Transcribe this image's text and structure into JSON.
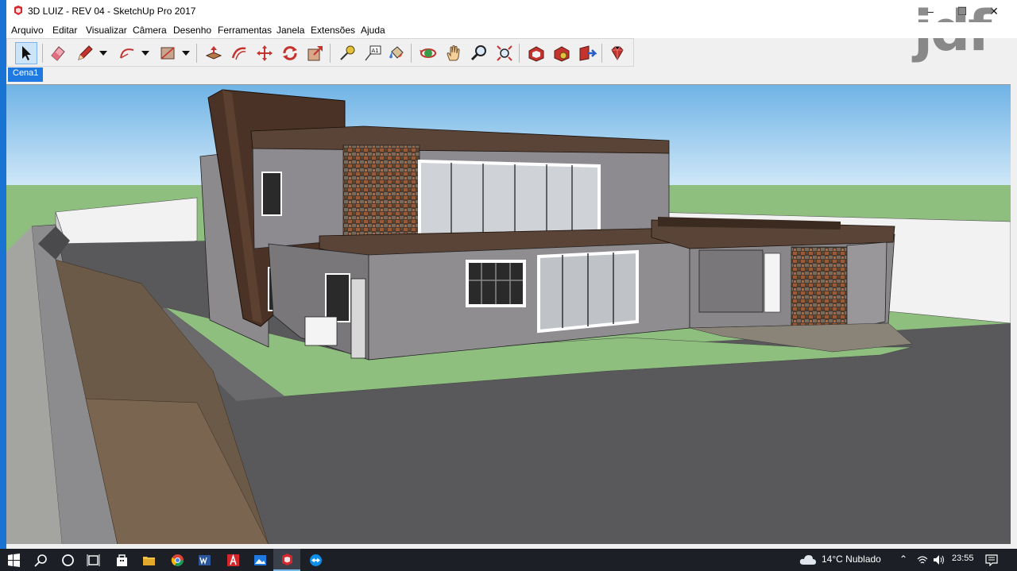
{
  "window": {
    "title": "3D LUIZ - REV 04 - SketchUp Pro 2017",
    "minimize_label": "–",
    "maximize_label": "☐",
    "close_label": "✕"
  },
  "watermark": "jdf",
  "menu": [
    "Arquivo",
    "Editar",
    "Visualizar",
    "Câmera",
    "Desenho",
    "Ferramentas",
    "Janela",
    "Extensões",
    "Ajuda"
  ],
  "toolbar": {
    "tools": [
      "select-tool",
      "eraser-tool",
      "line-tool",
      "arc-tool",
      "rectangle-tool",
      "push-pull-tool",
      "offset-tool",
      "move-tool",
      "rotate-tool",
      "scale-tool",
      "tape-measure-tool",
      "text-tool",
      "paint-bucket-tool",
      "orbit-tool",
      "pan-tool",
      "zoom-tool",
      "zoom-extents-tool",
      "3d-warehouse-tool",
      "extension-warehouse-tool",
      "layout-send-tool",
      "extension-manager-tool"
    ],
    "text_tool_label": "A1"
  },
  "scenes": [
    "Cena1"
  ],
  "taskbar": {
    "apps": [
      "windows-start",
      "search",
      "cortana",
      "task-view",
      "store",
      "file-explorer",
      "chrome",
      "word",
      "acrobat",
      "photos",
      "sketchup",
      "teamviewer"
    ],
    "active_app": "sketchup",
    "weather_temp": "14°C",
    "weather_text": "Nublado",
    "time": "23:55"
  },
  "colors": {
    "accent": "#1e7ae0",
    "sky_top": "#6fb3e6",
    "ground": "#8fbf7f"
  }
}
